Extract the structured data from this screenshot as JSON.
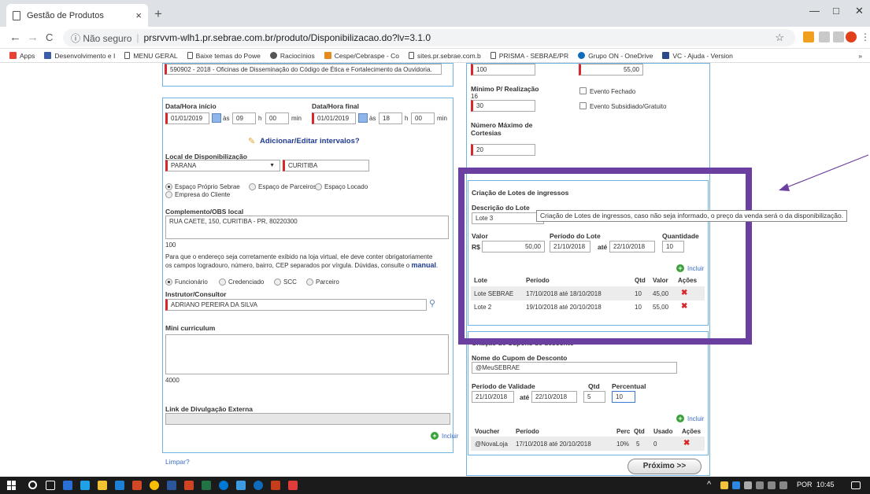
{
  "browser": {
    "tab_title": "Gestão de Produtos",
    "tab_close": "×",
    "new_tab": "+",
    "win_min": "—",
    "win_max": "□",
    "win_close": "✕",
    "back": "←",
    "forward": "→",
    "reload": "C",
    "security": "ⓘ Não seguro",
    "url": "prsrvvm-wlh1.pr.sebrae.com.br/produto/Disponibilizacao.do?lv=3.1.0",
    "star": "☆",
    "menu": "⋮",
    "bookmarks": [
      {
        "label": "Apps",
        "icon": "apps-grid-icon",
        "color": "#e94235"
      },
      {
        "label": "Desenvolvimento e I",
        "icon": "award-icon",
        "color": "#3b5ea8"
      },
      {
        "label": "MENU GERAL",
        "icon": "page-icon",
        "color": "#555"
      },
      {
        "label": "Baixe temas do Powe",
        "icon": "page-icon",
        "color": "#555"
      },
      {
        "label": "Raciocínios",
        "icon": "circle-icon",
        "color": "#555"
      },
      {
        "label": "Cespe/Cebraspe - Co",
        "icon": "cespe-icon",
        "color": "#e58a1f"
      },
      {
        "label": "sites.pr.sebrae.com.b",
        "icon": "page-icon",
        "color": "#555"
      },
      {
        "label": "PRISMA - SEBRAE/PR",
        "icon": "page-icon",
        "color": "#555"
      },
      {
        "label": "Grupo ON - OneDrive",
        "icon": "cloud-icon",
        "color": "#0f6cbd"
      },
      {
        "label": "VC - Ajuda - Version",
        "icon": "vc-icon",
        "color": "#2b4a8a"
      }
    ],
    "bookmarks_more": "»"
  },
  "left": {
    "course": "590902 - 2018 - Oficinas de Disseminação do Código de Ética e Fortalecimento da Ouvidoria.",
    "start_label": "Data/Hora início",
    "start_date": "01/01/2019",
    "as1": "às",
    "start_h": "09",
    "h1": "h",
    "start_min": "00",
    "min1": "min",
    "end_label": "Data/Hora final",
    "end_date": "01/01/2019",
    "as2": "às",
    "end_h": "18",
    "h2": "h",
    "end_min": "00",
    "min2": "min",
    "intervals_link": "Adicionar/Editar intervalos?",
    "local_label": "Local de Disponibilização",
    "state": "PARANA",
    "city": "CURITIBA",
    "space_options": [
      "Espaço Próprio Sebrae",
      "Espaço de Parceiros",
      "Espaço Locado",
      "Empresa do Cliente"
    ],
    "complement_label": "Complemento/OBS local",
    "complement_value": "RUA CAETE, 150, CURITIBA - PR, 80220300",
    "complement_count": "100",
    "address_help_1": "Para que o endereço seja corretamente exibido na loja virtual, ele deve conter obrigatoriamente",
    "address_help_2": "os campos logradouro, número, bairro, CEP separados por vírgula. Dúvidas, consulte o",
    "manual_link": "manual",
    "manual_dot": ".",
    "instructor_types": [
      "Funcionário",
      "Credenciado",
      "SCC",
      "Parceiro"
    ],
    "instructor_label": "Instrutor/Consultor",
    "instructor_value": "ADRIANO PEREIRA DA SILVA",
    "mini_label": "Mini curriculum",
    "mini_count": "4000",
    "ext_link_label": "Link de Divulgação Externa",
    "incluir": "Incluir",
    "limpar": "Limpar?"
  },
  "right": {
    "price_top_left": "100",
    "price_top_right": "55,00",
    "min_label": "Mínimo P/ Realização",
    "min_value_small": "16",
    "min_value": "30",
    "evento_fechado": "Evento Fechado",
    "evento_subsidiado": "Evento Subsidiado/Gratuito",
    "max_label_1": "Número Máximo de",
    "max_label_2": "Cortesias",
    "max_value": "20"
  },
  "lotes": {
    "title": "Criação de Lotes de ingressos",
    "desc_label": "Descrição do Lote",
    "desc_value": "Lote 3",
    "valor_label": "Valor",
    "periodo_label": "Período do Lote",
    "qtd_label": "Quantidade",
    "currency": "R$",
    "valor_value": "50,00",
    "period_start": "21/10/2018",
    "ate": "até",
    "period_end": "22/10/2018",
    "qtd_value": "10",
    "incluir": "Incluir",
    "headers": [
      "Lote",
      "Período",
      "Qtd",
      "Valor",
      "Ações"
    ],
    "rows": [
      {
        "lote": "Lote SEBRAE",
        "periodo": "17/10/2018 até 18/10/2018",
        "qtd": "10",
        "valor": "45,00"
      },
      {
        "lote": "Lote 2",
        "periodo": "19/10/2018 até 20/10/2018",
        "qtd": "10",
        "valor": "55,00"
      }
    ],
    "tooltip": "Criação de Lotes de ingressos, caso não seja informado, o preço da venda será o da disponibilização."
  },
  "cupons": {
    "title": "Criação de Cupons de desconto",
    "name_label": "Nome do Cupom de Desconto",
    "name_value": "@MeuSEBRAE",
    "validade_label": "Período de Validade",
    "qtd_label": "Qtd",
    "perc_label": "Percentual",
    "start": "21/10/2018",
    "ate": "até",
    "end": "22/10/2018",
    "qtd_value": "5",
    "perc_value": "10",
    "incluir": "Incluir",
    "headers": [
      "Voucher",
      "Período",
      "Perc",
      "Qtd",
      "Usado",
      "Ações"
    ],
    "rows": [
      {
        "voucher": "@NovaLoja",
        "periodo": "17/10/2018 até 20/10/2018",
        "perc": "10%",
        "qtd": "5",
        "usado": "0"
      }
    ]
  },
  "proximo": "Próximo >>",
  "taskbar": {
    "lang": "POR",
    "time": "10:45"
  }
}
